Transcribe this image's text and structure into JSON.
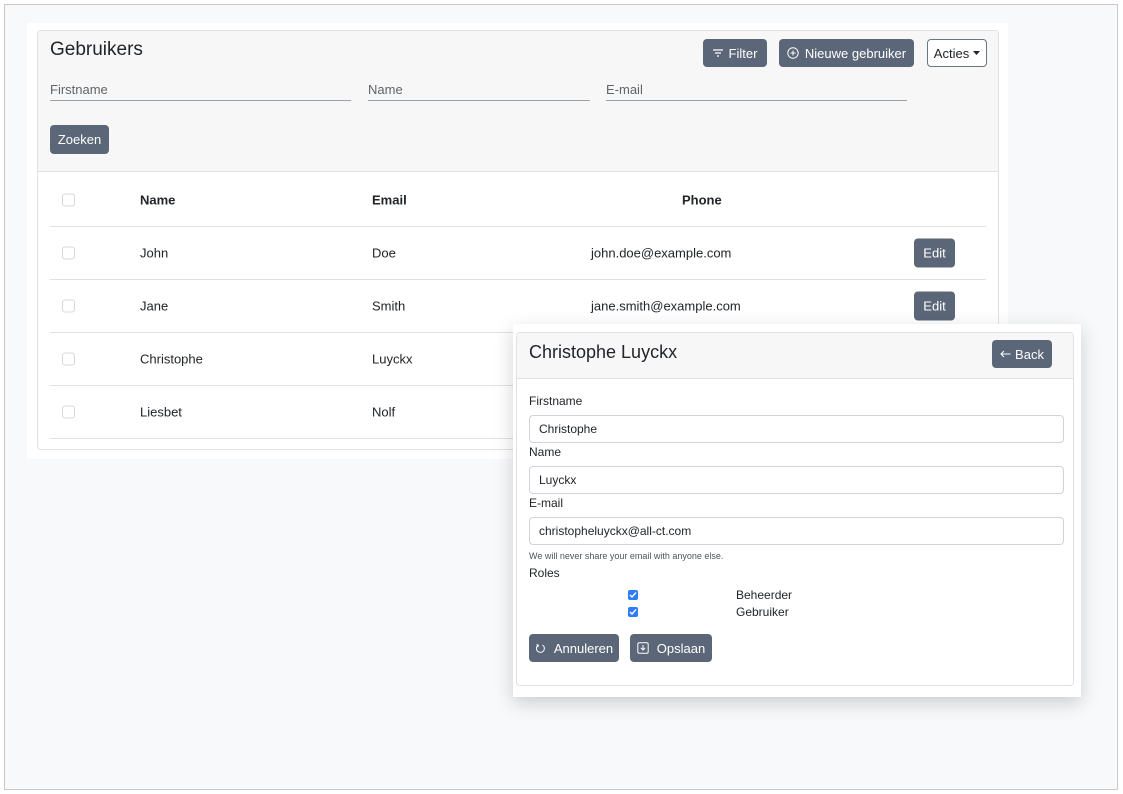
{
  "users_panel": {
    "title": "Gebruikers",
    "buttons": {
      "filter": "Filter",
      "new_user": "Nieuwe gebruiker",
      "actions": "Acties"
    },
    "filters": {
      "firstname": "Firstname",
      "name": "Name",
      "email": "E-mail"
    },
    "search_button": "Zoeken",
    "table": {
      "headers": [
        "Name",
        "Email",
        "Phone"
      ],
      "edit_label": "Edit",
      "rows": [
        {
          "col1": "John",
          "col2": "Doe",
          "col3": "john.doe@example.com",
          "edit": true
        },
        {
          "col1": "Jane",
          "col2": "Smith",
          "col3": "jane.smith@example.com",
          "edit": true
        },
        {
          "col1": "Christophe",
          "col2": "Luyckx",
          "col3": "",
          "edit": false
        },
        {
          "col1": "Liesbet",
          "col2": "Nolf",
          "col3": "",
          "edit": false
        }
      ]
    }
  },
  "detail_panel": {
    "title": "Christophe Luyckx",
    "back_button": "Back",
    "fields": {
      "firstname": {
        "label": "Firstname",
        "value": "Christophe"
      },
      "name": {
        "label": "Name",
        "value": "Luyckx"
      },
      "email": {
        "label": "E-mail",
        "value": "christopheluyckx@all-ct.com"
      }
    },
    "email_help": "We will never share your email with anyone else.",
    "roles_label": "Roles",
    "roles": [
      {
        "label": "Beheerder",
        "checked": true
      },
      {
        "label": "Gebruiker",
        "checked": true
      }
    ],
    "cancel_button": "Annuleren",
    "save_button": "Opslaan"
  },
  "colors": {
    "button_dark": "#5b6778",
    "checkbox_checked": "#2f7df6",
    "header_bg": "#f7f7f7"
  },
  "icons": {
    "filter": "filter-lines-icon",
    "new_user": "plus-circle-icon",
    "actions": "caret-down-icon",
    "back": "arrow-left-icon",
    "cancel": "undo-icon",
    "save": "download-icon"
  }
}
